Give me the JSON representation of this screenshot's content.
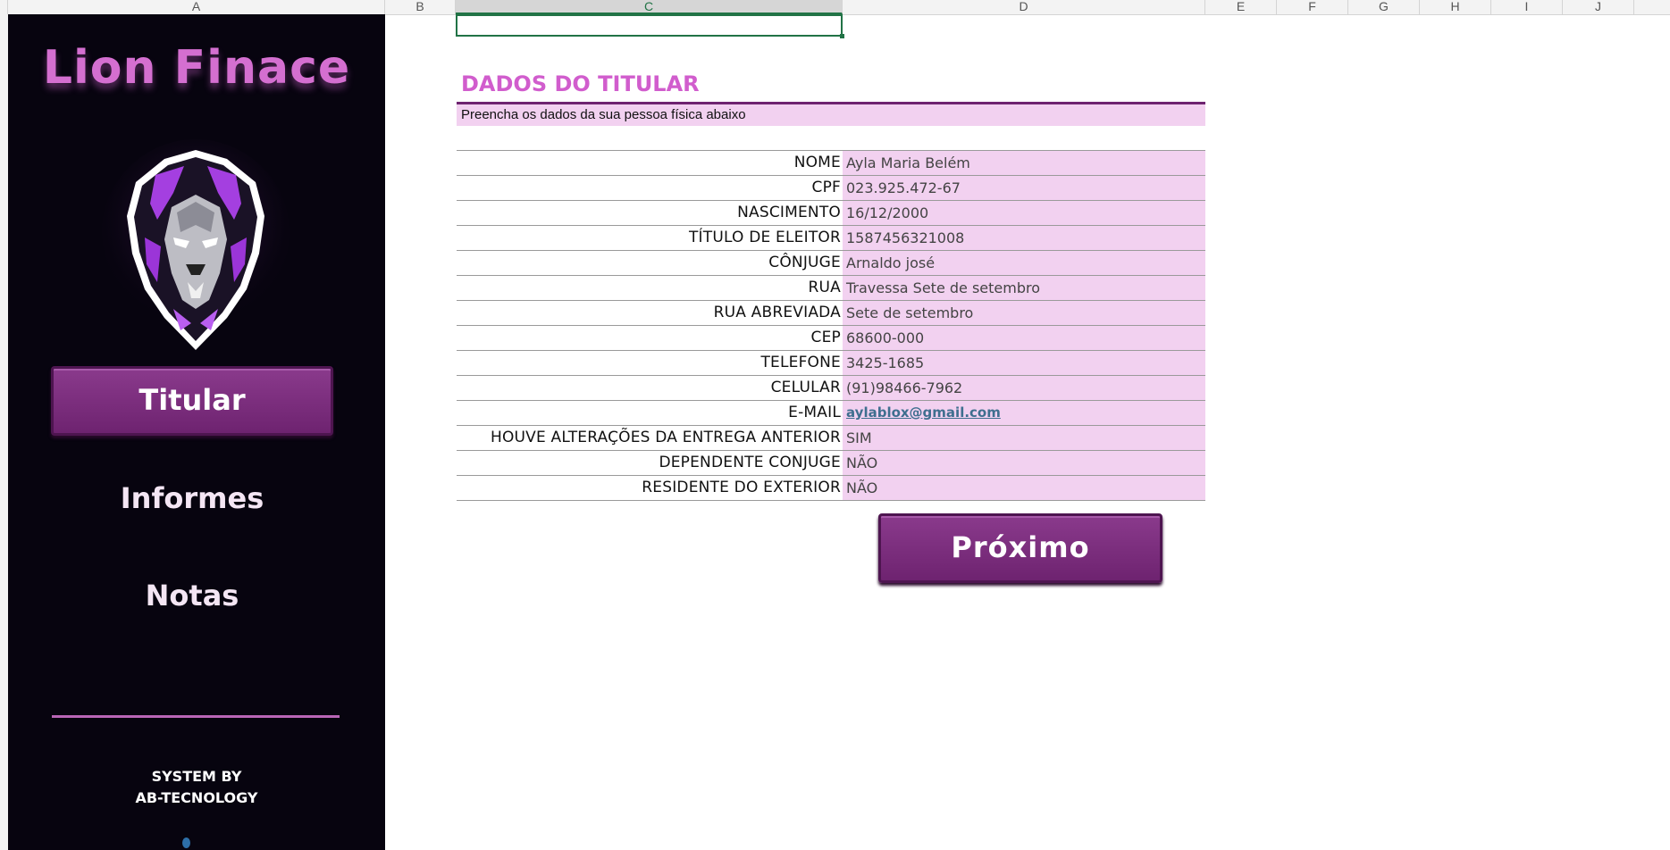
{
  "columns": [
    "A",
    "B",
    "C",
    "D",
    "E",
    "F",
    "G",
    "H",
    "I",
    "J"
  ],
  "sidebar": {
    "brand": "Lion Finace",
    "nav": {
      "titular": "Titular",
      "informes": "Informes",
      "notas": "Notas"
    },
    "system_by_line1": "SYSTEM BY",
    "system_by_line2": "AB-TECNOLOGY"
  },
  "form": {
    "title": "DADOS DO TITULAR",
    "subtitle": "Preencha os dados da sua pessoa física abaixo",
    "fields": [
      {
        "label": "NOME",
        "value": "Ayla Maria Belém"
      },
      {
        "label": "CPF",
        "value": "023.925.472-67"
      },
      {
        "label": "NASCIMENTO",
        "value": "16/12/2000"
      },
      {
        "label": "TÍTULO DE ELEITOR",
        "value": "1587456321008"
      },
      {
        "label": "CÔNJUGE",
        "value": "Arnaldo josé"
      },
      {
        "label": "RUA",
        "value": "Travessa Sete de setembro"
      },
      {
        "label": "RUA ABREVIADA",
        "value": "Sete de setembro"
      },
      {
        "label": "CEP",
        "value": "68600-000"
      },
      {
        "label": "TELEFONE",
        "value": "3425-1685"
      },
      {
        "label": "CELULAR",
        "value": "(91)98466-7962"
      },
      {
        "label": "E-MAIL",
        "value": "aylablox@gmail.com"
      },
      {
        "label": "HOUVE ALTERAÇÕES DA ENTREGA ANTERIOR",
        "value": "SIM"
      },
      {
        "label": "DEPENDENTE CONJUGE",
        "value": "NÃO"
      },
      {
        "label": "RESIDENTE DO EXTERIOR",
        "value": "NÃO"
      }
    ],
    "next_button": "Próximo"
  },
  "colors": {
    "accent": "#6e2370",
    "title": "#d15dcd",
    "highlight": "#f2d1f0",
    "sidebar_bg": "#07040f",
    "selection": "#217346"
  }
}
